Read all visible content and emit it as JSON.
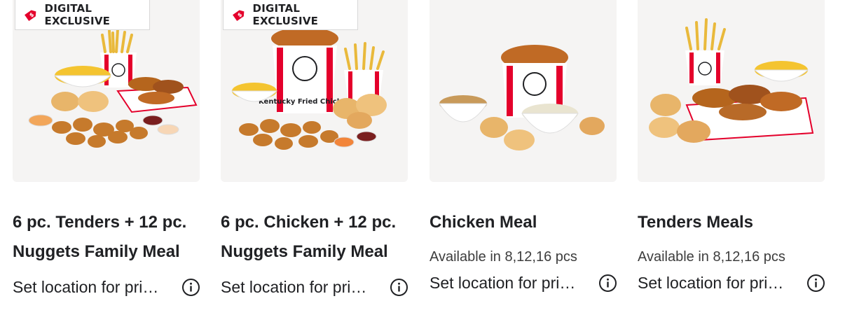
{
  "products": [
    {
      "badge": "DIGITAL EXCLUSIVE",
      "title_line1": "6 pc. Tenders + 12 pc.",
      "title_line2": "Nuggets Family Meal",
      "availability": "",
      "price_prompt": "Set location for pri…"
    },
    {
      "badge": "DIGITAL EXCLUSIVE",
      "title_line1": "6 pc. Chicken + 12 pc.",
      "title_line2": "Nuggets Family Meal",
      "availability": "",
      "price_prompt": "Set location for pri…"
    },
    {
      "badge": "",
      "title_line1": "Chicken Meal",
      "title_line2": "",
      "availability": "Available in 8,12,16 pcs",
      "price_prompt": "Set location for pri…"
    },
    {
      "badge": "",
      "title_line1": "Tenders Meals",
      "title_line2": "",
      "availability": "Available in 8,12,16 pcs",
      "price_prompt": "Set location for pri…"
    }
  ],
  "bucket_text": "Kentucky Fried Chicken",
  "colors": {
    "brand_red": "#e4002b",
    "card_bg": "#f5f4f3",
    "text": "#202124"
  },
  "icons": [
    "price-tag-icon",
    "info-icon"
  ]
}
